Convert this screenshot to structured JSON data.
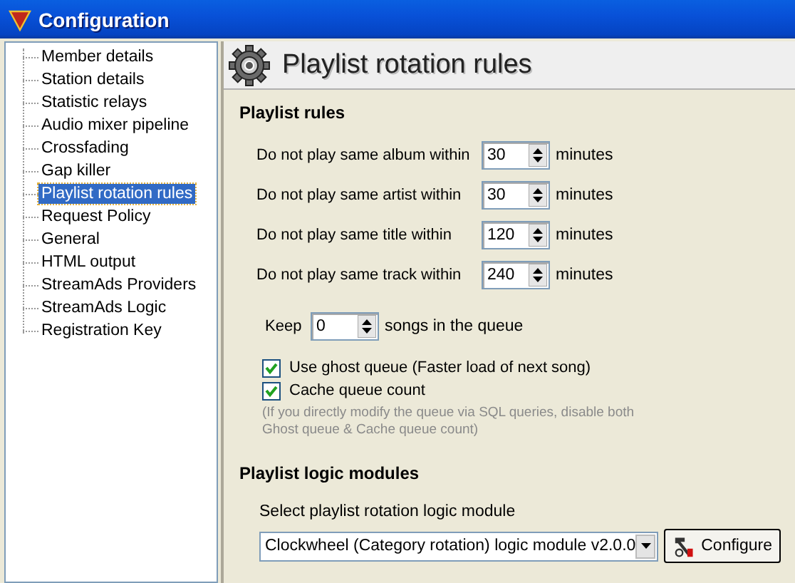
{
  "window": {
    "title": "Configuration"
  },
  "sidebar": {
    "items": [
      {
        "label": "Member details",
        "selected": false
      },
      {
        "label": "Station details",
        "selected": false
      },
      {
        "label": "Statistic relays",
        "selected": false
      },
      {
        "label": "Audio mixer pipeline",
        "selected": false
      },
      {
        "label": "Crossfading",
        "selected": false
      },
      {
        "label": "Gap killer",
        "selected": false
      },
      {
        "label": "Playlist rotation rules",
        "selected": true
      },
      {
        "label": "Request Policy",
        "selected": false
      },
      {
        "label": "General",
        "selected": false
      },
      {
        "label": "HTML output",
        "selected": false
      },
      {
        "label": "StreamAds Providers",
        "selected": false
      },
      {
        "label": "StreamAds Logic",
        "selected": false
      },
      {
        "label": "Registration Key",
        "selected": false
      }
    ]
  },
  "page": {
    "title": "Playlist rotation rules"
  },
  "playlist_rules": {
    "heading": "Playlist rules",
    "rules": [
      {
        "label": "Do not play same album within",
        "value": "30",
        "unit": "minutes"
      },
      {
        "label": "Do not play same artist within",
        "value": "30",
        "unit": "minutes"
      },
      {
        "label": "Do not play same title within",
        "value": "120",
        "unit": "minutes"
      },
      {
        "label": "Do not play same track within",
        "value": "240",
        "unit": "minutes"
      }
    ],
    "keep": {
      "label": "Keep",
      "value": "0",
      "unit": "songs in the queue"
    },
    "options": [
      {
        "label": "Use ghost queue (Faster load of next song)",
        "checked": true
      },
      {
        "label": "Cache queue count",
        "checked": true
      }
    ],
    "note": "(If you directly modify the queue via SQL queries, disable both Ghost queue & Cache queue count)"
  },
  "logic_modules": {
    "heading": "Playlist logic modules",
    "select_label": "Select playlist rotation logic module",
    "selected_module": "Clockwheel (Category rotation) logic module v2.0.0",
    "configure_button": "Configure"
  }
}
